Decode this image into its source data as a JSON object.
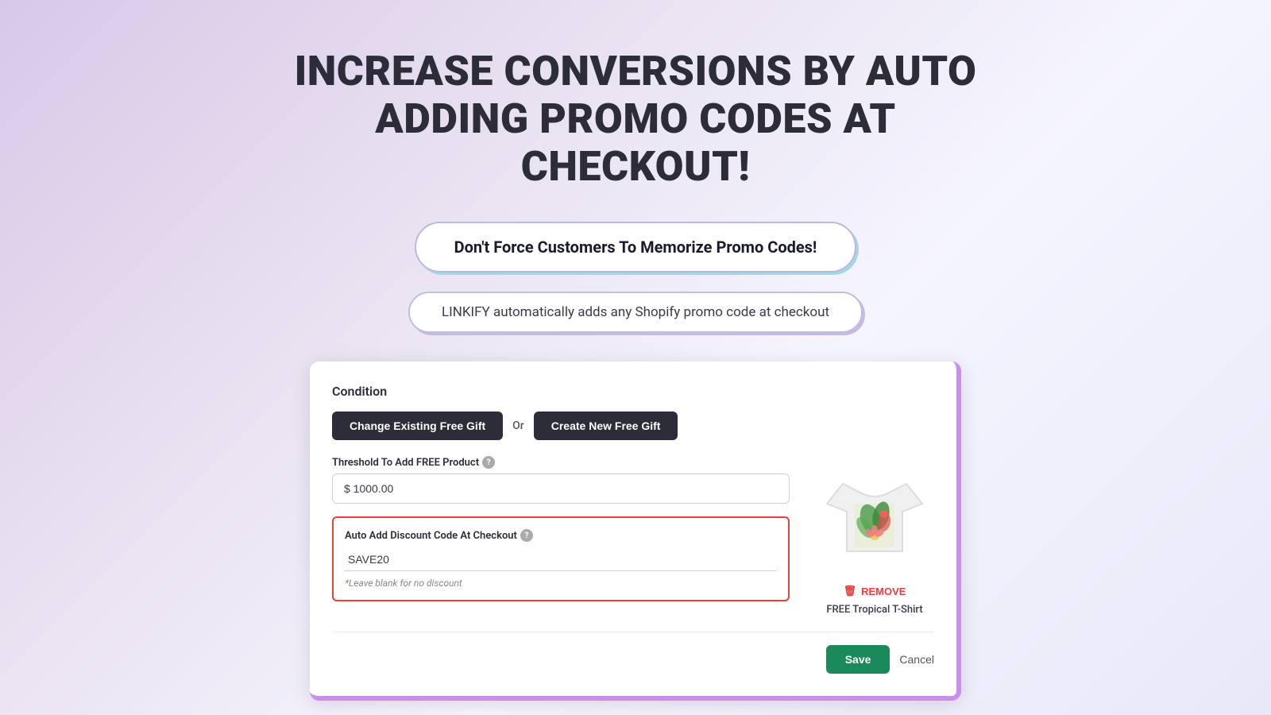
{
  "headline": {
    "line1": "INCREASE CONVERSIONS BY AUTO",
    "line2": "ADDING PROMO CODES AT CHECKOUT!"
  },
  "pill_primary": {
    "text": "Don't Force Customers To Memorize Promo Codes!"
  },
  "pill_secondary": {
    "text": "LINKIFY automatically adds any Shopify promo code at checkout"
  },
  "card": {
    "condition_label": "Condition",
    "button_change": "Change Existing Free Gift",
    "or_text": "Or",
    "button_create": "Create New Free Gift",
    "threshold_label": "Threshold To Add FREE Product",
    "threshold_value": "$ 1000.00",
    "threshold_placeholder": "$ 1000.00",
    "discount_label": "Auto Add Discount Code At Checkout",
    "discount_value": "SAVE20",
    "discount_hint": "*Leave blank for no discount",
    "product_name": "FREE Tropical T-Shirt",
    "remove_label": "REMOVE",
    "save_label": "Save",
    "cancel_label": "Cancel"
  },
  "icons": {
    "help": "?",
    "trash": "🗑"
  }
}
